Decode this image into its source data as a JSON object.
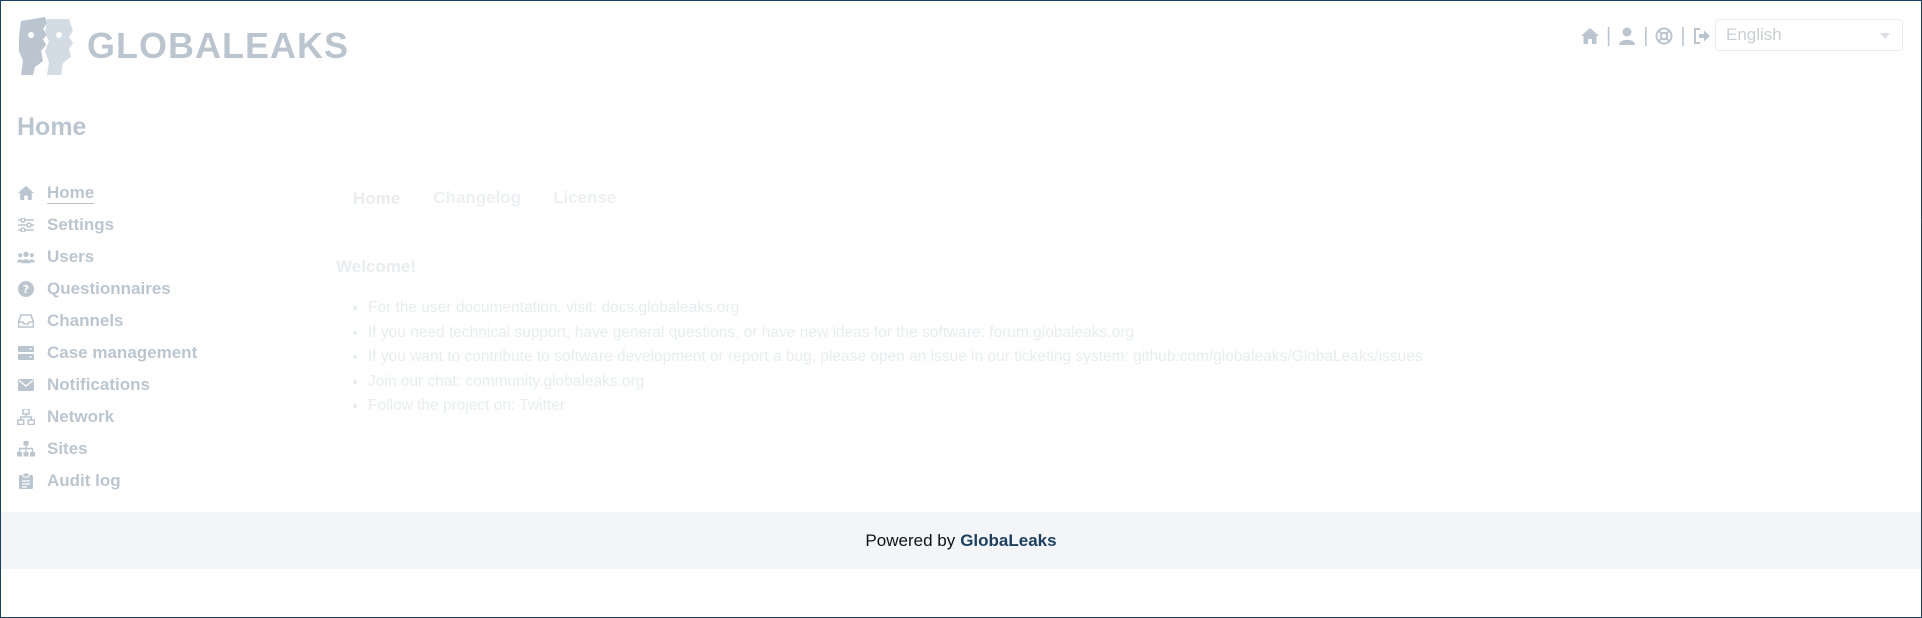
{
  "header": {
    "logo_text": "GLOBALEAKS",
    "separator": "|",
    "icons": [
      "home-icon",
      "user-icon",
      "support-icon",
      "logout-icon"
    ],
    "language": {
      "selected": "English"
    }
  },
  "page": {
    "title": "Home"
  },
  "sidebar": {
    "items": [
      {
        "label": "Home",
        "icon": "home-icon",
        "active": true
      },
      {
        "label": "Settings",
        "icon": "sliders-icon"
      },
      {
        "label": "Users",
        "icon": "users-icon"
      },
      {
        "label": "Questionnaires",
        "icon": "question-icon"
      },
      {
        "label": "Channels",
        "icon": "inbox-icon"
      },
      {
        "label": "Case management",
        "icon": "server-icon"
      },
      {
        "label": "Notifications",
        "icon": "envelope-icon"
      },
      {
        "label": "Network",
        "icon": "network-icon"
      },
      {
        "label": "Sites",
        "icon": "sitemap-icon"
      },
      {
        "label": "Audit log",
        "icon": "clipboard-icon"
      }
    ]
  },
  "main": {
    "tabs": [
      {
        "label": "Home",
        "active": true
      },
      {
        "label": "Changelog"
      },
      {
        "label": "License"
      }
    ],
    "welcome": "Welcome!",
    "links": [
      "For the user documentation, visit: docs.globaleaks.org",
      "If you need technical support, have general questions, or have new ideas for the software: forum.globaleaks.org",
      "If you want to contribute to software development or report a bug, please open an issue in our ticketing system: github.com/globaleaks/GlobaLeaks/issues",
      "Join our chat: community.globaleaks.org",
      "Follow the project on: Twitter"
    ]
  },
  "footer": {
    "prefix": "Powered by",
    "brand": "GlobaLeaks"
  },
  "colors": {
    "primary": "#1c3f5e",
    "footer_bg": "#f3f5f8",
    "border": "#1c3f5e"
  }
}
